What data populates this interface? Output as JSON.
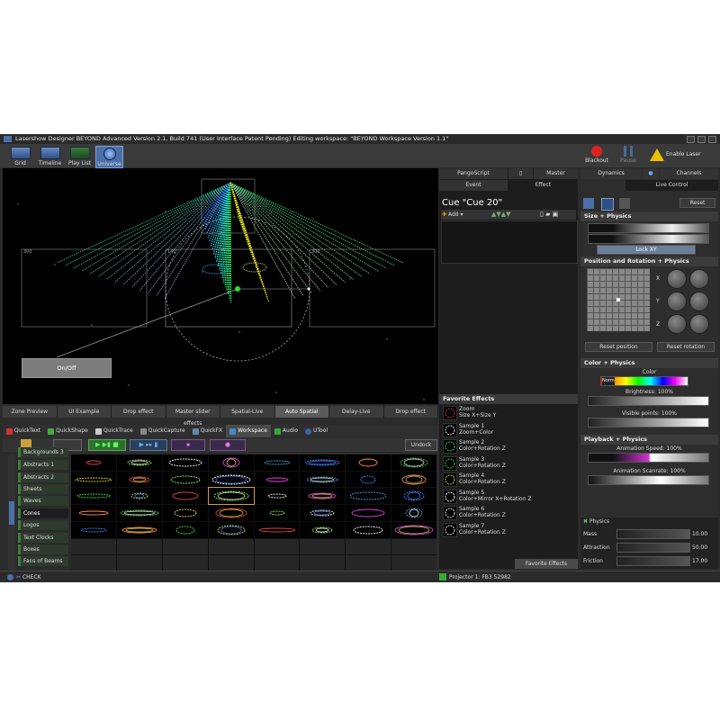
{
  "window": {
    "title": "Lasershow Designer BEYOND Advanced    Version 2.1, Build 741   (User Interface Patent Pending)   Editing workspace: \"BEYOND Workspace Version 1.1\""
  },
  "toolbar": {
    "views": [
      {
        "label": "Grid"
      },
      {
        "label": "Timeline"
      },
      {
        "label": "Play List"
      },
      {
        "label": "Universe"
      }
    ],
    "blackout": "Blackout",
    "pause": "Pause",
    "enable_output": "Enable Laser Output"
  },
  "stage": {
    "zone_labels": [
      "300",
      "140",
      "300"
    ],
    "onoff_button": "On/Off"
  },
  "zone_tabs": [
    "Zone Preview",
    "UI Example",
    "Drop effect",
    "Master slider effects",
    "Spatial-Live",
    "Auto Spatial",
    "Delay-Live",
    "Drop effect"
  ],
  "bottom_tabs": [
    "QuickText",
    "QuickShape",
    "QuickTrace",
    "QuickCapture",
    "QuickFX",
    "Workspace",
    "Audio",
    "UTool"
  ],
  "undock": "Undock",
  "categories": [
    "Backgrounds 3",
    "Abstracts 1",
    "Abstracts 2",
    "Sheets",
    "Waves",
    "Cones",
    "Logos",
    "Text Clocks",
    "Boxes",
    "Fans of Beams"
  ],
  "status": {
    "check": "CHECK",
    "projector": "Projector 1: FB3 52982"
  },
  "middle_panel": {
    "tabs_top": [
      "PangoScript",
      "",
      "Master"
    ],
    "tabs_bottom": [
      "Event",
      "Effect"
    ],
    "cue_title": "Cue \"Cue 20\"",
    "add_label": "Add",
    "favorite_header": "Favorite Effects",
    "favorites": [
      {
        "name": "Zoom",
        "detail": "Size X+Size Y"
      },
      {
        "name": "Sample 1",
        "detail": "Zoom+Color"
      },
      {
        "name": "Sample 2",
        "detail": "Color+Rotation Z"
      },
      {
        "name": "Sample 3",
        "detail": "Color+Rotation Z"
      },
      {
        "name": "Sample 4",
        "detail": "Color+Rotation Z"
      },
      {
        "name": "Sample 5",
        "detail": "Color+Mirror X+Rotation Z"
      },
      {
        "name": "Sample 6",
        "detail": "Color+Rotation Z"
      },
      {
        "name": "Sample 7",
        "detail": "Color+Rotation Z"
      }
    ],
    "footer_tab": "Favorite Effects"
  },
  "right_panel": {
    "tabs_top": [
      "Dynamics",
      "Channels"
    ],
    "tabs_bottom": [
      "Live Control"
    ],
    "reset": "Reset",
    "size_header": "Size + Physics",
    "lock_xy": "Lock XY",
    "position_header": "Position and Rotation + Physics",
    "axes": [
      "X",
      "Y",
      "Z"
    ],
    "reset_position": "Reset position",
    "reset_rotation": "Reset rotation",
    "color_header": "Color + Physics",
    "color_label": "Color",
    "color_mode": "Norm",
    "brightness": "Brightness: 100%",
    "visible_points": "Visible points: 100%",
    "playback_header": "Playback + Physics",
    "animation_speed": "Animation Speed: 100%",
    "animation_scanrate": "Animation Scanrate: 100%",
    "physics_header": "Physics",
    "physics": [
      {
        "label": "Mass",
        "value": "10.00"
      },
      {
        "label": "Attraction",
        "value": "50.00"
      },
      {
        "label": "Friction",
        "value": "17.00"
      }
    ]
  },
  "colors": {
    "accent": "#4b6fa8",
    "background": "#2b2b2b",
    "stage": "#000000",
    "selected_tab": "#5b5b5b"
  }
}
